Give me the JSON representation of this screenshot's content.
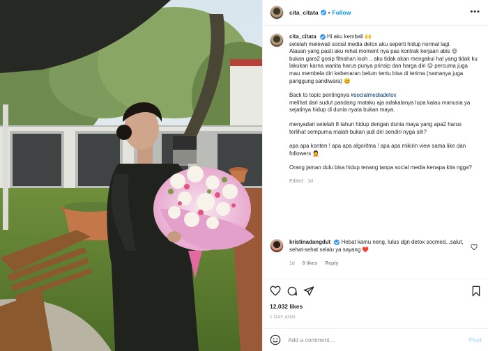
{
  "post": {
    "username": "cita_citata",
    "follow_label": "Follow",
    "separator": "•",
    "more_label": "•••"
  },
  "caption": {
    "username": "cita_citata",
    "lines": [
      "Hi aku kembali 🙌",
      "setelah melewati social media detox aku seperti hidup normal lagi.",
      "Alasan yang pasti aku rehat moment nya pas kontrak kerjaan abis 😌",
      "bukan gara2 gosip fitnahan looh .. aku tidak akan mengakui hal yang tidak ku lakukan karna wanita harus punya prinsip dan harga diri 😌  percuma juga mau membela diri kebenaran belum tentu bisa di terima (namanya juga panggung sandiwara) 🥴",
      "Back to topic pentingnya ",
      "melihat dari sudut pandang mataku aja adakalanya lupa kalau manusia ya sejatinya hidup di dunia nyata bukan maya.",
      "menyadari setelah 8 tahun hidup dengan dunia maya yang apa2 harus terlihat sempurna malah bukan jadi diri sendiri nyga sih?",
      "apa apa konten ! apa apa algoritma ! apa apa mikirin view sama like dan followers 🤦",
      "Orang jaman dulu bisa hidup tenang tanpa social media kenapa kita ngga?"
    ],
    "hashtag": "#socialmediadetox",
    "edited": "Edited",
    "edited_ago": "1d"
  },
  "comment": {
    "username": "kristinadangdut",
    "text": "Hebat kamu neng, lulus dgn detox socmed...salut, sehat-sehat selalu ya sayang ❤️",
    "time": "1d",
    "likes": "9 likes",
    "reply_label": "Reply"
  },
  "engagement": {
    "likes": "12,032 likes",
    "time_ago": "1 DAY AGO"
  },
  "add_comment": {
    "placeholder": "Add a comment…",
    "post_label": "Post"
  },
  "icons": {
    "like": "heart-icon",
    "comment": "comment-bubble-icon",
    "share": "paper-plane-icon",
    "save": "bookmark-icon",
    "emoji": "smiley-icon",
    "verified": "verified-badge-icon"
  },
  "colors": {
    "link_blue": "#0095f6",
    "verified_blue": "#3897f0",
    "hashtag": "#00376b",
    "muted": "#8e8e8e",
    "heart_red": "#ed4956"
  }
}
